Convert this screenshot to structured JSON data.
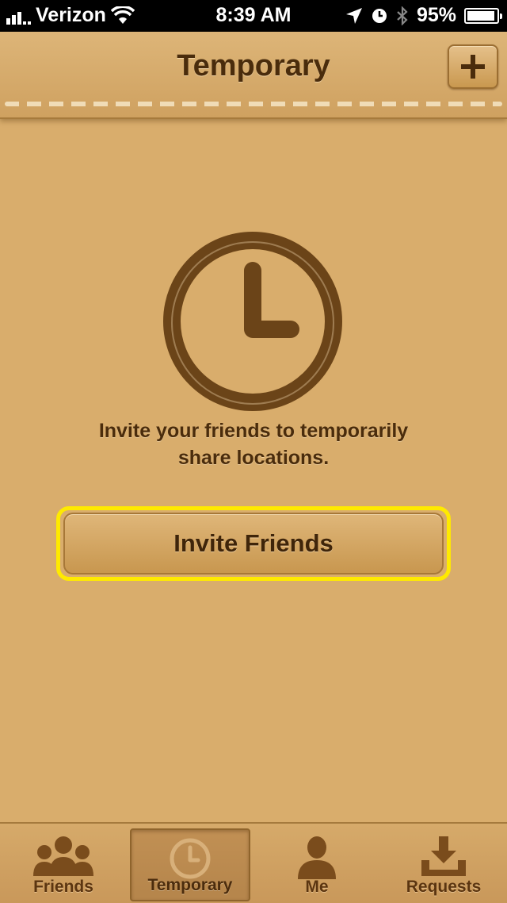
{
  "status_bar": {
    "carrier": "Verizon",
    "time": "8:39 AM",
    "battery": "95%",
    "battery_level": 0.95
  },
  "header": {
    "title": "Temporary",
    "add_icon": "plus-icon"
  },
  "main": {
    "illustration_icon": "clock-icon",
    "message_line1": "Invite your friends to temporarily",
    "message_line2": "share locations.",
    "invite_button_label": "Invite Friends"
  },
  "tab_bar": {
    "tabs": [
      {
        "label": "Friends",
        "icon": "friends-icon",
        "active": false
      },
      {
        "label": "Temporary",
        "icon": "clock-icon",
        "active": true
      },
      {
        "label": "Me",
        "icon": "person-icon",
        "active": false
      },
      {
        "label": "Requests",
        "icon": "inbox-download-icon",
        "active": false
      }
    ]
  },
  "colors": {
    "leather": "#d9ad6c",
    "text_brown": "#4a2c0c",
    "highlight": "#ffea00"
  }
}
